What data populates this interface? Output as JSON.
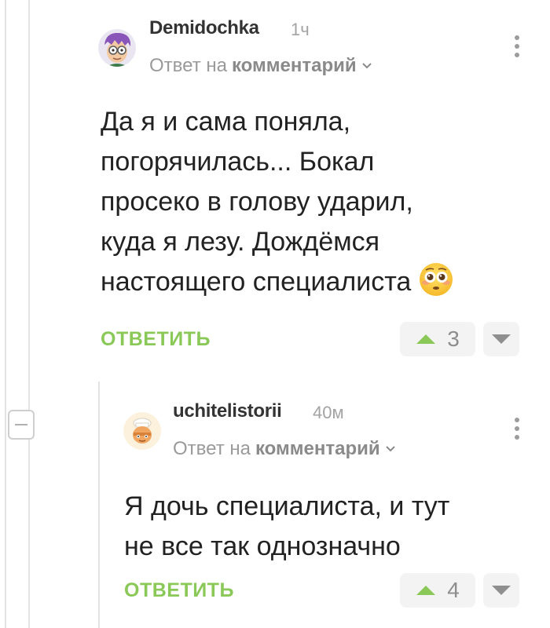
{
  "comments": [
    {
      "username": "Demidochka",
      "time": "1ч",
      "reply_prefix": "Ответ на",
      "reply_target": "комментарий",
      "text_lines": [
        "Да я и сама поняла,",
        "погорячилась... Бокал",
        "просеко в голову ударил,",
        "куда я лезу. Дождёмся",
        "настоящего специалиста"
      ],
      "reply_label": "ОТВЕТИТЬ",
      "score": "3"
    },
    {
      "username": "uchitelistorii",
      "time": "40м",
      "reply_prefix": "Ответ на",
      "reply_target": "комментарий",
      "text_lines": [
        "Я дочь специалиста, и тут",
        "не все так однозначно"
      ],
      "reply_label": "ОТВЕТИТЬ",
      "score": "4"
    }
  ],
  "colors": {
    "accent_green": "#8ac858",
    "vote_bg": "#f3f3f3",
    "thread_line": "#e3e3e3"
  },
  "icons": [
    "flushed-emoji-icon",
    "chevron-down-icon",
    "more-vertical-icon",
    "arrow-up-icon",
    "arrow-down-icon",
    "collapse-icon"
  ]
}
